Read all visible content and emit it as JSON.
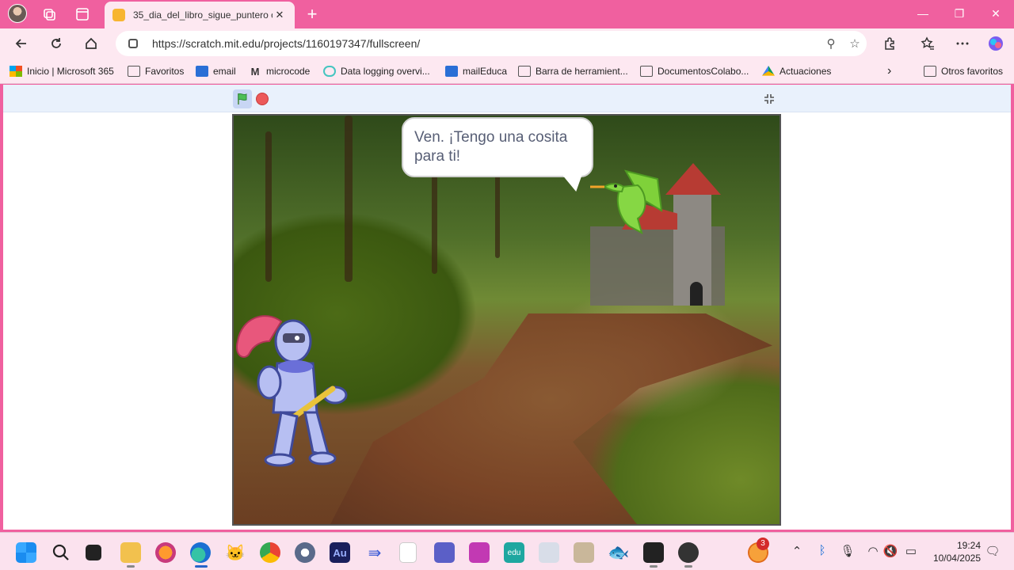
{
  "browser": {
    "tab_title": "35_dia_del_libro_sigue_puntero o",
    "tab_close": "✕",
    "new_tab": "+",
    "url": "https://scratch.mit.edu/projects/1160197347/fullscreen/",
    "window_controls": {
      "minimize": "—",
      "maximize": "❐",
      "close": "✕"
    }
  },
  "bookmarks": [
    {
      "label": "Inicio | Microsoft 365",
      "icon": "microsoft-icon"
    },
    {
      "label": "Favoritos",
      "icon": "folder-icon"
    },
    {
      "label": "email",
      "icon": "mail-icon"
    },
    {
      "label": "microcode",
      "icon": "m-icon"
    },
    {
      "label": "Data logging overvi...",
      "icon": "link-icon"
    },
    {
      "label": "mailEduca",
      "icon": "mail-icon"
    },
    {
      "label": "Barra de herramient...",
      "icon": "folder-icon"
    },
    {
      "label": "DocumentosColabo...",
      "icon": "folder-icon"
    },
    {
      "label": "Actuaciones",
      "icon": "drive-icon"
    },
    {
      "label": "Otros favoritos",
      "icon": "folder-icon"
    }
  ],
  "stage": {
    "speech_bubble": "Ven. ¡Tengo una cosita para ti!"
  },
  "taskbar": {
    "time": "19:24",
    "date": "10/04/2025",
    "notification_count": "3"
  },
  "colors": {
    "accent": "#f0609f",
    "chrome_bg": "#fde8f1",
    "scratch_bar": "#e9f1fc",
    "stop_red": "#ec5959"
  }
}
